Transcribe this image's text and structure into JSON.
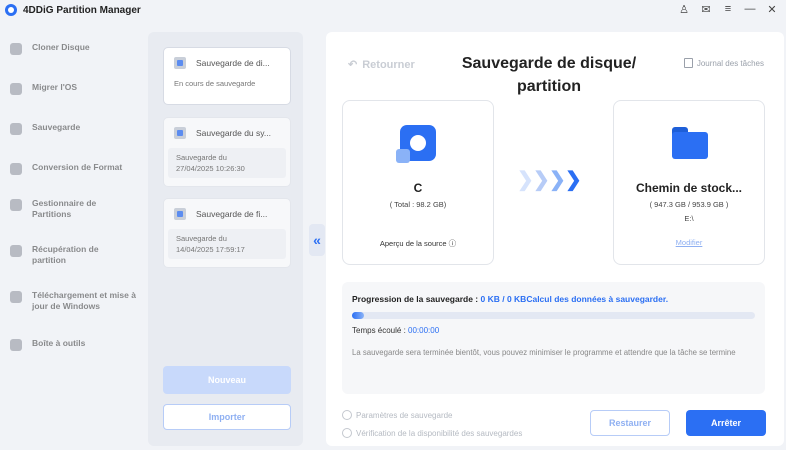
{
  "app": {
    "title": "4DDiG Partition Manager"
  },
  "window_controls": {
    "user": "♙",
    "feedback": "✉",
    "menu": "≡",
    "minimize": "—",
    "close": "✕"
  },
  "sidebar": {
    "items": [
      {
        "label": "Cloner Disque",
        "icon": "clone-disk-icon"
      },
      {
        "label": "Migrer l'OS",
        "icon": "migrate-os-icon"
      },
      {
        "label": "Sauvegarde",
        "icon": "backup-icon"
      },
      {
        "label": "Conversion de Format",
        "icon": "convert-format-icon"
      },
      {
        "label": "Gestionnaire de Partitions",
        "icon": "partition-manager-icon"
      },
      {
        "label": "Récupération de partition",
        "icon": "partition-recovery-icon"
      },
      {
        "label": "Téléchargement et mise à jour de Windows",
        "icon": "windows-download-icon"
      },
      {
        "label": "Boîte à outils",
        "icon": "toolbox-icon"
      }
    ]
  },
  "history": {
    "cards": [
      {
        "title": "Sauvegarde de di...",
        "status": "En cours de sauvegarde"
      },
      {
        "title": "Sauvegarde du sy...",
        "date_label": "Sauvegarde du",
        "date": "27/04/2025 10:26:30"
      },
      {
        "title": "Sauvegarde de fi...",
        "date_label": "Sauvegarde du",
        "date": "14/04/2025 17:59:17"
      }
    ],
    "new_label": "Nouveau",
    "import_label": "Importer",
    "collapse_glyph": "«"
  },
  "main": {
    "back_label": "Retourner",
    "title_line1": "Sauvegarde de disque/",
    "title_line2": "partition",
    "journal_label": "Journal des tâches",
    "source": {
      "name": "C",
      "total": "( Total : 98.2 GB)",
      "preview_label": "Aperçu de la source",
      "info_glyph": "ⓘ"
    },
    "destination": {
      "name": "Chemin de stock...",
      "capacity": "( 947.3 GB / 953.9 GB )",
      "path": "E:\\",
      "modify_label": "Modifier"
    },
    "progress": {
      "label": "Progression de la sauvegarde : ",
      "value": "0 KB / 0 KB",
      "status": "Calcul des données à sauvegarder.",
      "fraction": 0.03,
      "elapsed_label": "Temps écoulé : ",
      "elapsed_value": "00:00:00",
      "note": "La sauvegarde sera terminée bientôt, vous pouvez minimiser le programme et attendre que la tâche se termine"
    },
    "options": {
      "settings_label": "Paramètres de sauvegarde",
      "verify_label": "Vérification de la disponibilité des sauvegardes"
    },
    "restore_label": "Restaurer",
    "stop_label": "Arrêter"
  },
  "colors": {
    "accent": "#2b6ff3",
    "accent_light": "#c8d9fb"
  }
}
